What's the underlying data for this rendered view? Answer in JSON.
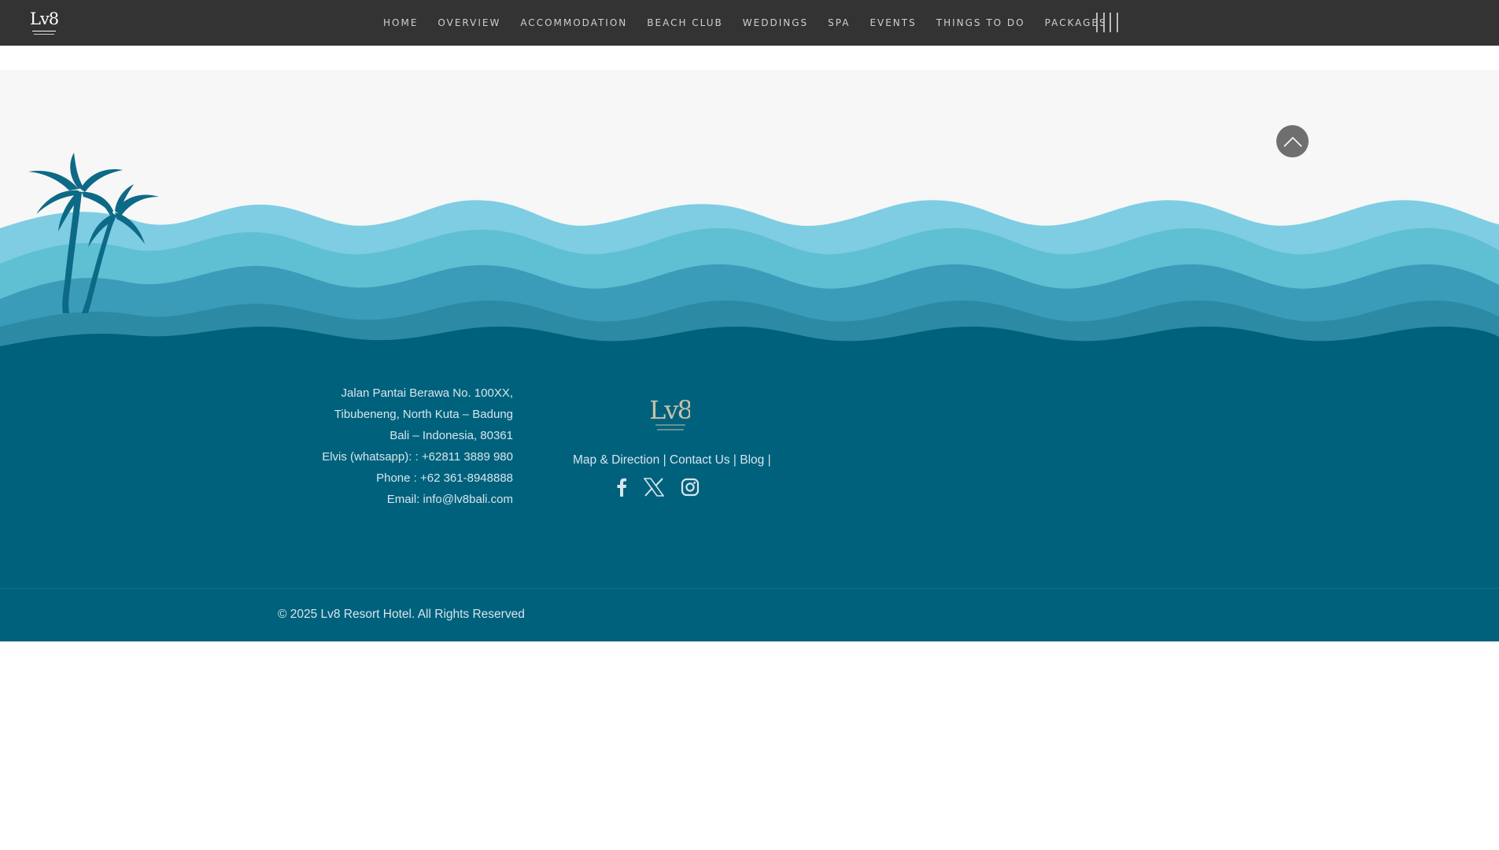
{
  "brand": {
    "logo_text": "Lv8"
  },
  "nav": {
    "items": [
      {
        "label": "HOME"
      },
      {
        "label": "OVERVIEW"
      },
      {
        "label": "ACCOMMODATION"
      },
      {
        "label": "BEACH CLUB"
      },
      {
        "label": "WEDDINGS"
      },
      {
        "label": "SPA"
      },
      {
        "label": "EVENTS"
      },
      {
        "label": "THINGS TO DO"
      },
      {
        "label": "PACKAGES"
      }
    ],
    "menu_icon": "menu-bars-icon"
  },
  "hero": {
    "scroll_top_icon": "chevron-up-icon"
  },
  "footer": {
    "address_lines": [
      "Jalan Pantai Berawa No. 100XX,",
      "Tibubeneng, North Kuta – Badung",
      "Bali – Indonesia, 80361",
      "Elvis (whatsapp): : +62811 3889 980",
      "Phone : +62 361-8948888"
    ],
    "email_label": "Email: ",
    "email": "info@lv8bali.com",
    "logo_text": "Lv8",
    "links": [
      {
        "label": "Map & Direction"
      },
      {
        "label": "Contact Us"
      },
      {
        "label": "Blog"
      }
    ],
    "link_separator": "|",
    "social": [
      {
        "icon": "facebook-icon"
      },
      {
        "icon": "x-twitter-icon"
      },
      {
        "icon": "instagram-icon"
      }
    ],
    "copyright": "© 2025 Lv8 Resort Hotel. All Rights Reserved"
  },
  "colors": {
    "nav_bg": "#333333",
    "hero_bg": "#f7f7f7",
    "footer_bg": "#00617d",
    "wave_light": "#7ecde3",
    "wave_mid": "#5fbfd3",
    "wave_dark": "#3a9cb8",
    "palm": "#0d6a86"
  }
}
